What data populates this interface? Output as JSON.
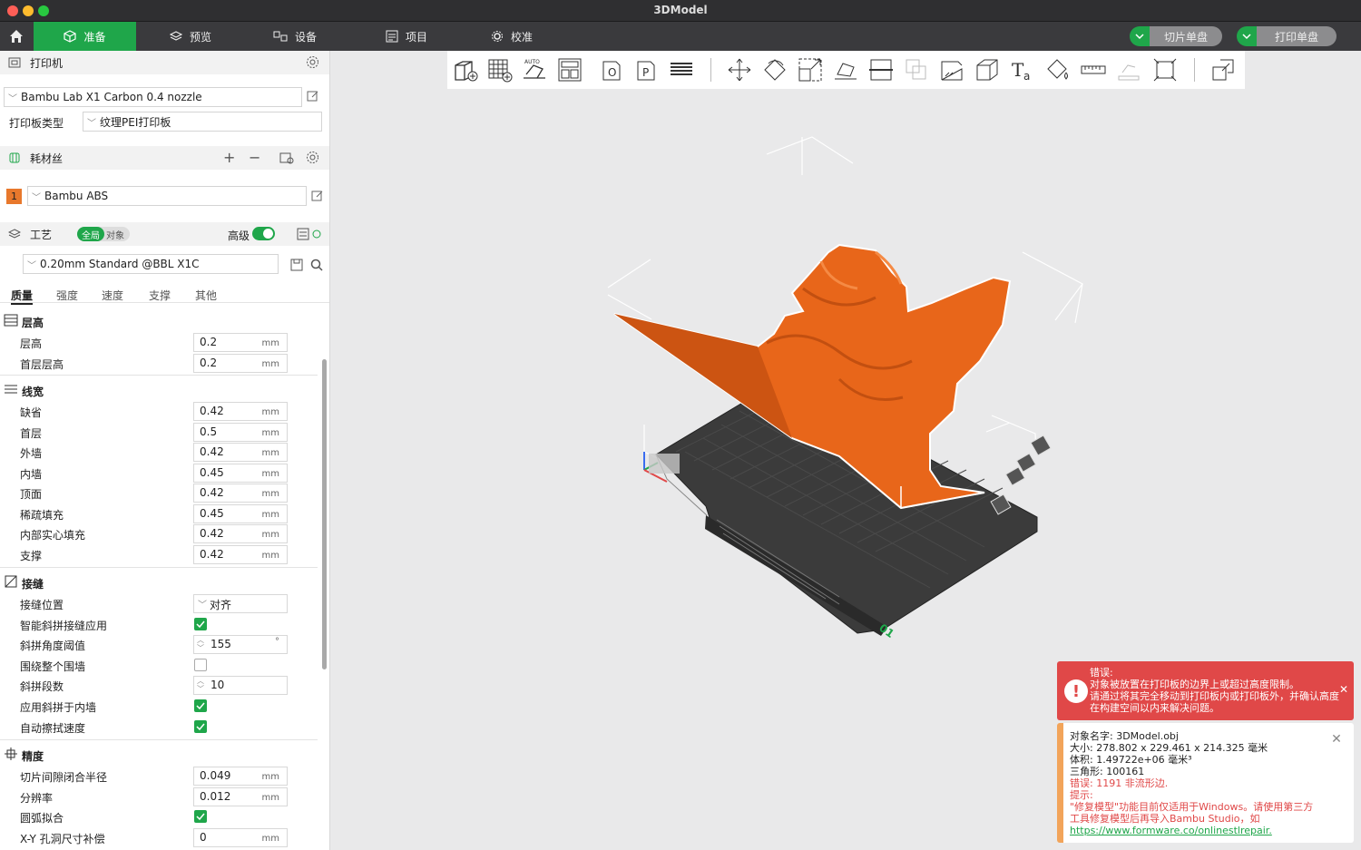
{
  "window": {
    "title": "3DModel"
  },
  "tabs": [
    {
      "label": "准备",
      "icon": "cube-icon"
    },
    {
      "label": "预览",
      "icon": "layers-icon"
    },
    {
      "label": "设备",
      "icon": "device-icon"
    },
    {
      "label": "项目",
      "icon": "project-icon"
    },
    {
      "label": "校准",
      "icon": "gear-icon"
    }
  ],
  "actions": {
    "slice_plate": "切片单盘",
    "print_plate": "打印单盘"
  },
  "printer": {
    "section_title": "打印机",
    "selected": "Bambu Lab X1 Carbon 0.4 nozzle",
    "plate_type_label": "打印板类型",
    "plate_type": "纹理PEI打印板"
  },
  "filament": {
    "section_title": "耗材丝",
    "slot_number": "1",
    "slot_color": "#e8782c",
    "selected": "Bambu ABS"
  },
  "process": {
    "section_title": "工艺",
    "toggle_global": "全局",
    "toggle_object": "对象",
    "advanced_label": "高级",
    "advanced_on": true,
    "preset": "0.20mm Standard @BBL X1C",
    "subtabs": [
      "质量",
      "强度",
      "速度",
      "支撑",
      "其他"
    ],
    "active_subtab": "质量"
  },
  "settings": {
    "layer_height": {
      "title": "层高",
      "rows": [
        {
          "label": "层高",
          "value": "0.2",
          "unit": "mm"
        },
        {
          "label": "首层层高",
          "value": "0.2",
          "unit": "mm"
        }
      ]
    },
    "line_width": {
      "title": "线宽",
      "rows": [
        {
          "label": "缺省",
          "value": "0.42",
          "unit": "mm"
        },
        {
          "label": "首层",
          "value": "0.5",
          "unit": "mm"
        },
        {
          "label": "外墙",
          "value": "0.42",
          "unit": "mm"
        },
        {
          "label": "内墙",
          "value": "0.45",
          "unit": "mm"
        },
        {
          "label": "顶面",
          "value": "0.42",
          "unit": "mm"
        },
        {
          "label": "稀疏填充",
          "value": "0.45",
          "unit": "mm"
        },
        {
          "label": "内部实心填充",
          "value": "0.42",
          "unit": "mm"
        },
        {
          "label": "支撑",
          "value": "0.42",
          "unit": "mm"
        }
      ]
    },
    "seam": {
      "title": "接缝",
      "position_label": "接缝位置",
      "position_value": "对齐",
      "smart_scarf_label": "智能斜拼接缝应用",
      "smart_scarf": true,
      "scarf_angle_label": "斜拼角度阈值",
      "scarf_angle_value": "155",
      "scarf_angle_unit": "°",
      "whole_wall_label": "围绕整个围墙",
      "whole_wall": false,
      "scarf_steps_label": "斜拼段数",
      "scarf_steps_value": "10",
      "inner_wall_label": "应用斜拼于内墙",
      "inner_wall": true,
      "auto_speed_label": "自动擦拭速度",
      "auto_speed": true
    },
    "precision": {
      "title": "精度",
      "gap_label": "切片间隙闭合半径",
      "gap_value": "0.049",
      "gap_unit": "mm",
      "resolution_label": "分辨率",
      "resolution_value": "0.012",
      "resolution_unit": "mm",
      "arc_label": "圆弧拟合",
      "arc": true,
      "xy_hole_label": "X-Y 孔洞尺寸补偿",
      "xy_hole_value": "0",
      "xy_hole_unit": "mm"
    }
  },
  "error": {
    "title": "错误:",
    "line1": "对象被放置在打印板的边界上或超过高度限制。",
    "line2": "请通过将其完全移动到打印板内或打印板外，并确认高度",
    "line3": "在构建空间以内来解决问题。"
  },
  "info": {
    "name": "对象名字:  3DModel.obj",
    "size": "大小:    278.802 x 229.461 x 214.325 毫米",
    "volume": "体积:    1.49722e+06 毫米³",
    "triangles": "三角形:   100161",
    "errors": "错误: 1191 非流形边.",
    "hint_title": "提示:",
    "hint_line1": "\"修复模型\"功能目前仅适用于Windows。请使用第三方",
    "hint_line2": "工具修复模型后再导入Bambu Studio，如",
    "hint_link": "https://www.formware.co/onlinestlrepair."
  },
  "plate": {
    "label": "01"
  },
  "colors": {
    "accent": "#1fa64a",
    "model": "#e8661a",
    "error": "#e04848",
    "warning": "#f2a45a"
  }
}
